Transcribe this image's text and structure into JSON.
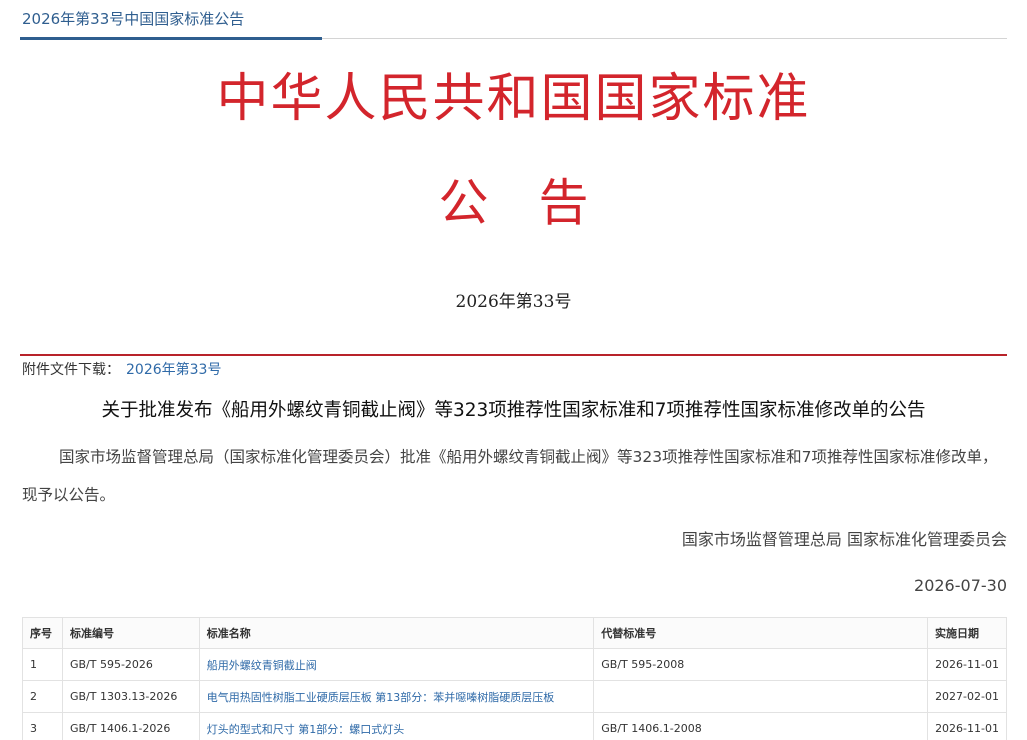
{
  "page": {
    "top_title": "2026年第33号中国国家标准公告",
    "headline": "中华人民共和国国家标准",
    "subhead": "公告",
    "issue_no": "2026年第33号",
    "attachment_label": "附件文件下载：",
    "attachment_link": "2026年第33号"
  },
  "notice": {
    "title": "关于批准发布《船用外螺纹青铜截止阀》等323项推荐性国家标准和7项推荐性国家标准修改单的公告",
    "body": "国家市场监督管理总局（国家标准化管理委员会）批准《船用外螺纹青铜截止阀》等323项推荐性国家标准和7项推荐性国家标准修改单，现予以公告。",
    "signer": "国家市场监督管理总局 国家标准化管理委员会",
    "date": "2026-07-30"
  },
  "table": {
    "headers": [
      "序号",
      "标准编号",
      "标准名称",
      "代替标准号",
      "实施日期"
    ],
    "rows": [
      {
        "no": "1",
        "code": "GB/T 595-2026",
        "name": "船用外螺纹青铜截止阀",
        "replaces": "GB/T 595-2008",
        "date": "2026-11-01"
      },
      {
        "no": "2",
        "code": "GB/T 1303.13-2026",
        "name": "电气用热固性树脂工业硬质层压板 第13部分：苯并噁嗪树脂硬质层压板",
        "replaces": "",
        "date": "2027-02-01"
      },
      {
        "no": "3",
        "code": "GB/T 1406.1-2026",
        "name": "灯头的型式和尺寸 第1部分：螺口式灯头",
        "replaces": "GB/T 1406.1-2008",
        "date": "2026-11-01"
      }
    ]
  },
  "colors": {
    "headline_red": "#d3252c",
    "link_blue": "#2f6aa8",
    "title_blue": "#2f5e8f"
  }
}
